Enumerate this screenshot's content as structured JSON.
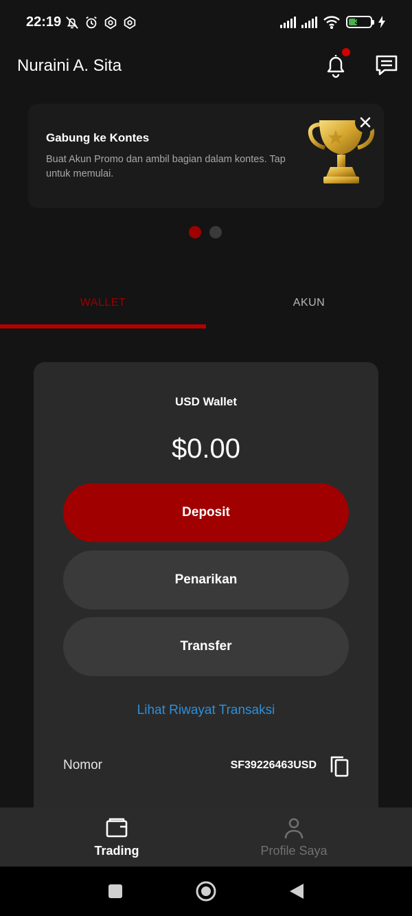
{
  "status_bar": {
    "time": "22:19",
    "battery_level": "39",
    "icons_left": [
      "bell-off-icon",
      "alarm-icon",
      "app-notification-icon",
      "app-notification-icon"
    ],
    "icons_right": [
      "signal-icon",
      "signal-icon",
      "wifi-icon",
      "battery-icon",
      "charging-icon"
    ]
  },
  "header": {
    "user_name": "Nuraini A. Sita",
    "icons": [
      "bell-icon",
      "messages-icon"
    ],
    "notification_dot": true
  },
  "promo": {
    "title": "Gabung ke Kontes",
    "description": "Buat Akun Promo dan ambil bagian dalam kontes. Tap untuk memulai.",
    "image": "trophy-icon",
    "close_icon": "close-icon"
  },
  "carousel": {
    "pages": 2,
    "active_index": 0
  },
  "tabs": {
    "items": [
      {
        "label": "WALLET",
        "active": true
      },
      {
        "label": "AKUN",
        "active": false
      }
    ]
  },
  "wallet": {
    "title": "USD Wallet",
    "balance": "$0.00",
    "deposit_label": "Deposit",
    "withdraw_label": "Penarikan",
    "transfer_label": "Transfer",
    "history_link": "Lihat Riwayat Transaksi",
    "account_label": "Nomor",
    "account_number": "SF39226463USD",
    "copy_icon": "copy-icon"
  },
  "bottom_nav": {
    "items": [
      {
        "label": "Trading",
        "icon": "wallet-icon",
        "active": true
      },
      {
        "label": "Profile Saya",
        "icon": "profile-icon",
        "active": false
      }
    ]
  },
  "system_nav": {
    "icons": [
      "recents-icon",
      "home-icon",
      "back-icon"
    ]
  },
  "colors": {
    "background": "#141414",
    "accent_red": "#a00000",
    "tab_active_text": "#9b0000",
    "underline": "#b30000",
    "link_blue": "#2f8fd8",
    "dot_inactive": "#3a3a3a"
  }
}
